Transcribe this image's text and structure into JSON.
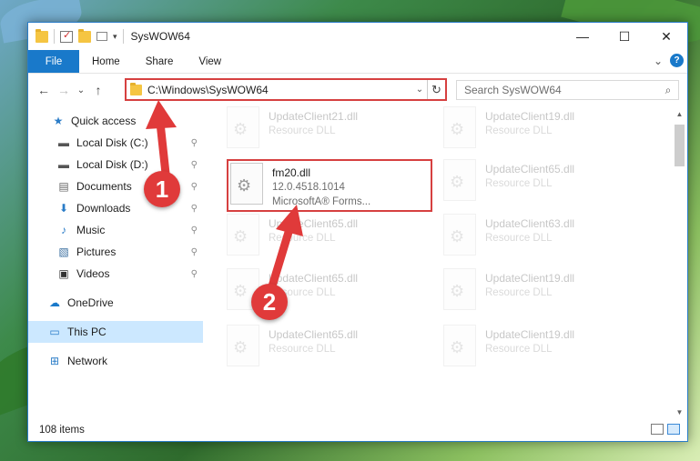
{
  "window": {
    "title": "SysWOW64",
    "minimize": "—",
    "maximize": "☐",
    "close": "✕"
  },
  "ribbon": {
    "tabs": [
      "File",
      "Home",
      "Share",
      "View"
    ],
    "expand": "⌄",
    "help": "?"
  },
  "nav": {
    "back": "←",
    "forward": "→",
    "recent": "⌄",
    "up": "↑",
    "address": "C:\\Windows\\SysWOW64",
    "address_dropdown": "⌄",
    "refresh": "↻",
    "search_placeholder": "Search SysWOW64",
    "search_icon": "⌕"
  },
  "sidebar": {
    "items": [
      {
        "label": "Quick access",
        "icon": "star-icon",
        "glyph": "★",
        "pinned": false
      },
      {
        "label": "Local Disk (C:)",
        "icon": "drive-icon",
        "glyph": "▬",
        "pinned": true
      },
      {
        "label": "Local Disk (D:)",
        "icon": "drive-icon",
        "glyph": "▬",
        "pinned": true
      },
      {
        "label": "Documents",
        "icon": "documents-icon",
        "glyph": "▤",
        "pinned": true
      },
      {
        "label": "Downloads",
        "icon": "download-icon",
        "glyph": "⬇",
        "pinned": true
      },
      {
        "label": "Music",
        "icon": "music-icon",
        "glyph": "♪",
        "pinned": true
      },
      {
        "label": "Pictures",
        "icon": "pictures-icon",
        "glyph": "▧",
        "pinned": true
      },
      {
        "label": "Videos",
        "icon": "videos-icon",
        "glyph": "▣",
        "pinned": true
      },
      {
        "label": "OneDrive",
        "icon": "cloud-icon",
        "glyph": "☁",
        "pinned": false
      },
      {
        "label": "This PC",
        "icon": "computer-icon",
        "glyph": "▭",
        "pinned": false
      },
      {
        "label": "Network",
        "icon": "network-icon",
        "glyph": "⊞",
        "pinned": false
      }
    ],
    "pin_glyph": "📌"
  },
  "files": {
    "highlighted": {
      "name": "fm20.dll",
      "version": "12.0.4518.1014",
      "description": "MicrosoftA® Forms..."
    },
    "background": [
      {
        "name": "UpdateClient21.dll",
        "type": "Resource DLL"
      },
      {
        "name": "UpdateClient19.dll",
        "type": "Resource DLL"
      },
      {
        "name": "UpdateClient65.dll",
        "type": "Resource DLL"
      },
      {
        "name": "UpdateClient65.dll",
        "type": "Resource DLL"
      },
      {
        "name": "UpdateClient63.dll",
        "type": "Resource DLL"
      },
      {
        "name": "UpdateClient65.dll",
        "type": "Resource DLL"
      },
      {
        "name": "UpdateClient19.dll",
        "type": "Resource DLL"
      },
      {
        "name": "UpdateClient65.dll",
        "type": "Resource DLL"
      },
      {
        "name": "UpdateClient19.dll",
        "type": "Resource DLL"
      }
    ]
  },
  "status": {
    "count": "108 items"
  },
  "annotations": {
    "step1": "1",
    "step2": "2",
    "color": "#e03a3a"
  }
}
